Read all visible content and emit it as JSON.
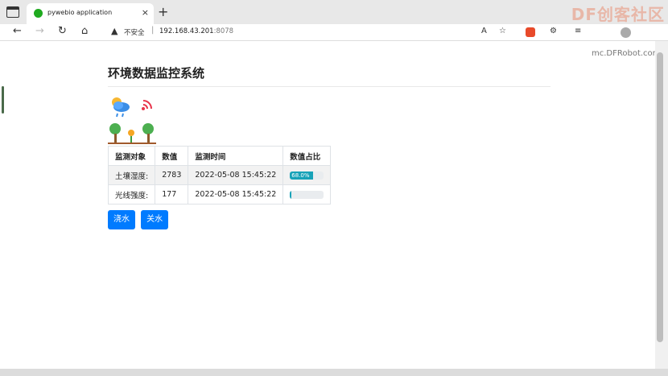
{
  "browser": {
    "tab_title": "pywebio application",
    "tab_close": "×",
    "new_tab": "+",
    "security_label": "不安全",
    "url_host": "192.168.43.201",
    "url_port": ":8078",
    "watermark": "DF创客社区",
    "watermark2": "mc.DFRobot.com.cn"
  },
  "page": {
    "title": "环境数据监控系统",
    "table": {
      "headers": [
        "监测对象",
        "数值",
        "监测时间",
        "数值占比"
      ],
      "rows": [
        {
          "object": "土壤湿度:",
          "value": "2783",
          "time": "2022-05-08 15:45:22",
          "percent": "68.0%",
          "ratio": 0.68
        },
        {
          "object": "光线强度:",
          "value": "177",
          "time": "2022-05-08 15:45:22",
          "percent": "",
          "ratio": 0.04
        }
      ]
    },
    "buttons": {
      "water": "浇水",
      "stop": "关水"
    }
  },
  "colors": {
    "primary": "#007bff",
    "progress": "#17a2b8"
  }
}
